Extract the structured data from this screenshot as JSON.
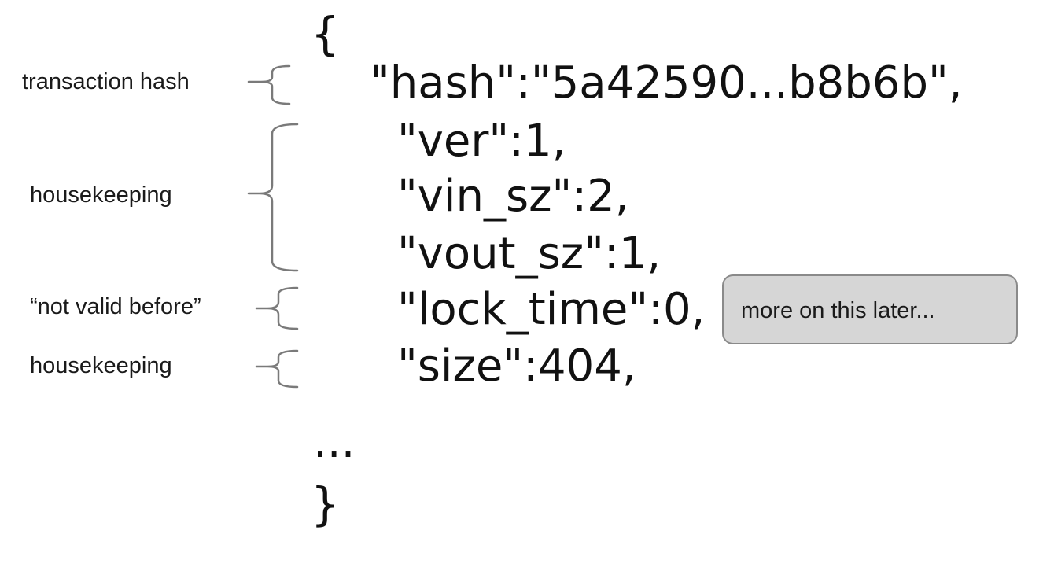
{
  "code": {
    "open_brace": "{",
    "hash_line": "\"hash\":\"5a42590...b8b6b\",",
    "ver_line": "\"ver\":1,",
    "vin_line": "\"vin_sz\":2,",
    "vout_line": "\"vout_sz\":1,",
    "lock_line": "\"lock_time\":0,",
    "size_line": "\"size\":404,",
    "ellipsis": "...",
    "close_brace": "}"
  },
  "annotations": {
    "hash_label": "transaction hash",
    "housekeeping_label": "housekeeping",
    "lock_label": "“not valid before”",
    "size_label": "housekeeping"
  },
  "callout": {
    "text": "more on this later..."
  }
}
